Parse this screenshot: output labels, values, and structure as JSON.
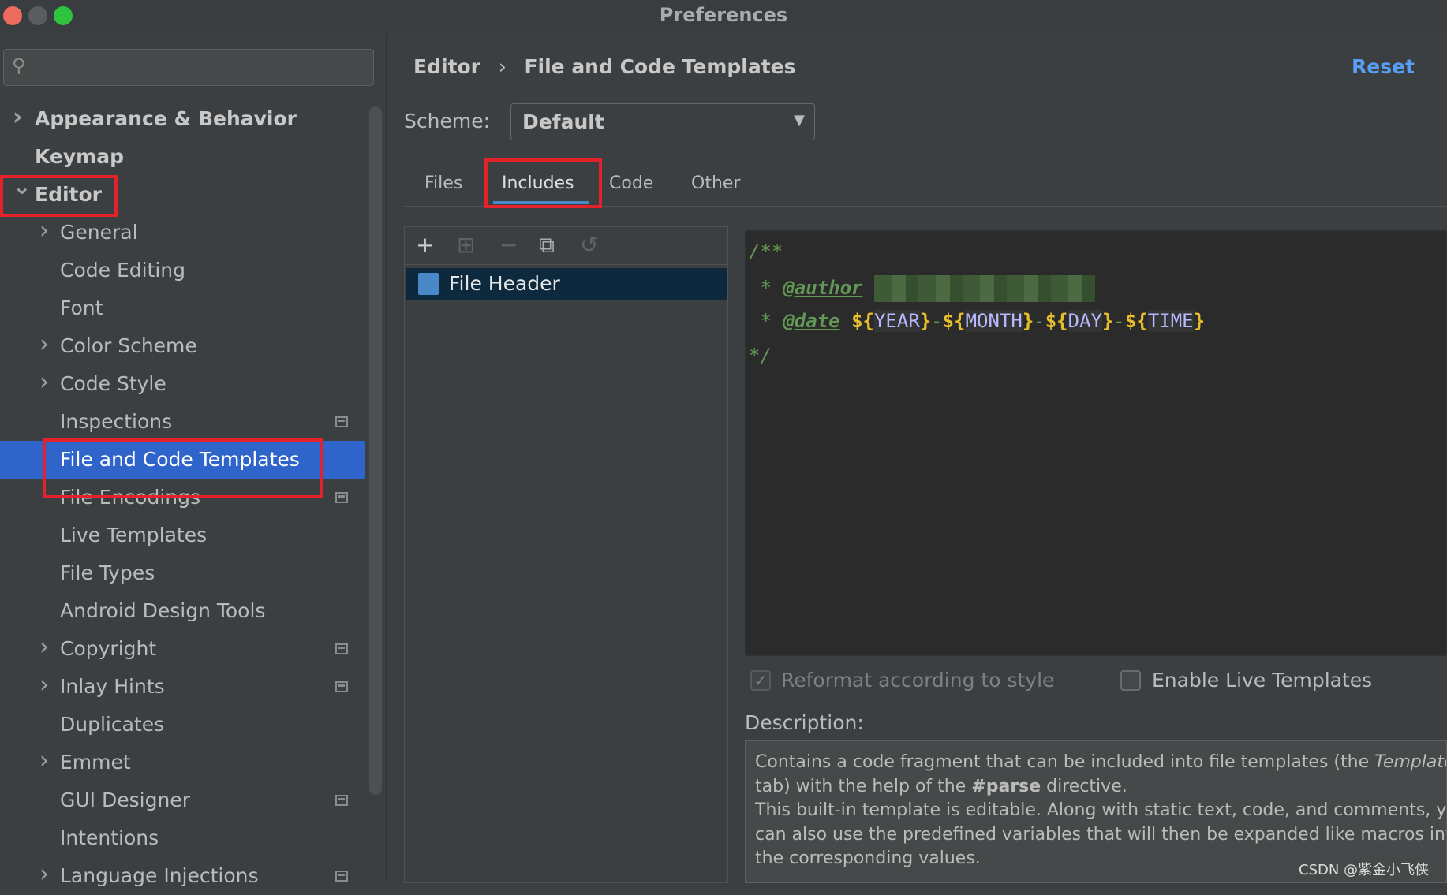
{
  "window": {
    "title": "Preferences"
  },
  "search": {
    "placeholder": ""
  },
  "sidebar": {
    "items": [
      {
        "label": "Appearance & Behavior",
        "level": 0,
        "chevron": "right"
      },
      {
        "label": "Keymap",
        "level": 0
      },
      {
        "label": "Editor",
        "level": 0,
        "chevron": "down"
      },
      {
        "label": "General",
        "level": 1,
        "chevron": "right"
      },
      {
        "label": "Code Editing",
        "level": 1
      },
      {
        "label": "Font",
        "level": 1
      },
      {
        "label": "Color Scheme",
        "level": 1,
        "chevron": "right"
      },
      {
        "label": "Code Style",
        "level": 1,
        "chevron": "right"
      },
      {
        "label": "Inspections",
        "level": 1,
        "project_icon": true
      },
      {
        "label": "File and Code Templates",
        "level": 1,
        "selected": true
      },
      {
        "label": "File Encodings",
        "level": 1,
        "project_icon": true
      },
      {
        "label": "Live Templates",
        "level": 1
      },
      {
        "label": "File Types",
        "level": 1
      },
      {
        "label": "Android Design Tools",
        "level": 1
      },
      {
        "label": "Copyright",
        "level": 1,
        "chevron": "right",
        "project_icon": true
      },
      {
        "label": "Inlay Hints",
        "level": 1,
        "chevron": "right",
        "project_icon": true
      },
      {
        "label": "Duplicates",
        "level": 1
      },
      {
        "label": "Emmet",
        "level": 1,
        "chevron": "right"
      },
      {
        "label": "GUI Designer",
        "level": 1,
        "project_icon": true
      },
      {
        "label": "Intentions",
        "level": 1
      },
      {
        "label": "Language Injections",
        "level": 1,
        "chevron": "right",
        "project_icon": true
      }
    ]
  },
  "header": {
    "breadcrumb": [
      "Editor",
      "File and Code Templates"
    ],
    "separator": "›",
    "reset": "Reset"
  },
  "scheme": {
    "label": "Scheme:",
    "value": "Default"
  },
  "tabs": [
    {
      "label": "Files"
    },
    {
      "label": "Includes",
      "active": true
    },
    {
      "label": "Code"
    },
    {
      "label": "Other"
    }
  ],
  "templates": {
    "items": [
      {
        "label": "File Header",
        "selected": true
      }
    ]
  },
  "editor": {
    "lines": {
      "open": "/**",
      "author_prefix": " * ",
      "author_tag": "@author",
      "date_prefix": " * ",
      "date_tag": "@date",
      "close": "*/"
    },
    "date_vars": [
      "YEAR",
      "MONTH",
      "DAY",
      "TIME"
    ],
    "dollar_open": "${",
    "close_brace": "}",
    "dash": "-"
  },
  "options": {
    "reformat": {
      "label": "Reformat according to style",
      "checked": true,
      "disabled": true
    },
    "live_templates": {
      "label": "Enable Live Templates",
      "checked": false
    }
  },
  "description": {
    "label": "Description:",
    "l1": "Contains a code fragment that can be included into file templates (the ",
    "l1_italic": "Templates",
    "l2a": "tab) with the help of the ",
    "l2_bold": "#parse",
    "l2b": " directive.",
    "l3": "This built-in template is editable. Along with static text, code, and comments, you",
    "l4": "can also use the predefined variables that will then be expanded like macros into",
    "l5": "the corresponding values."
  },
  "watermark": "CSDN @紫金小飞侠",
  "colors": {
    "selection": "#2f65ca",
    "highlight_box": "#e3222b",
    "link": "#589df6",
    "comment": "#629755",
    "variable": "#b8b8ff",
    "dollar": "#e8bf2a"
  }
}
